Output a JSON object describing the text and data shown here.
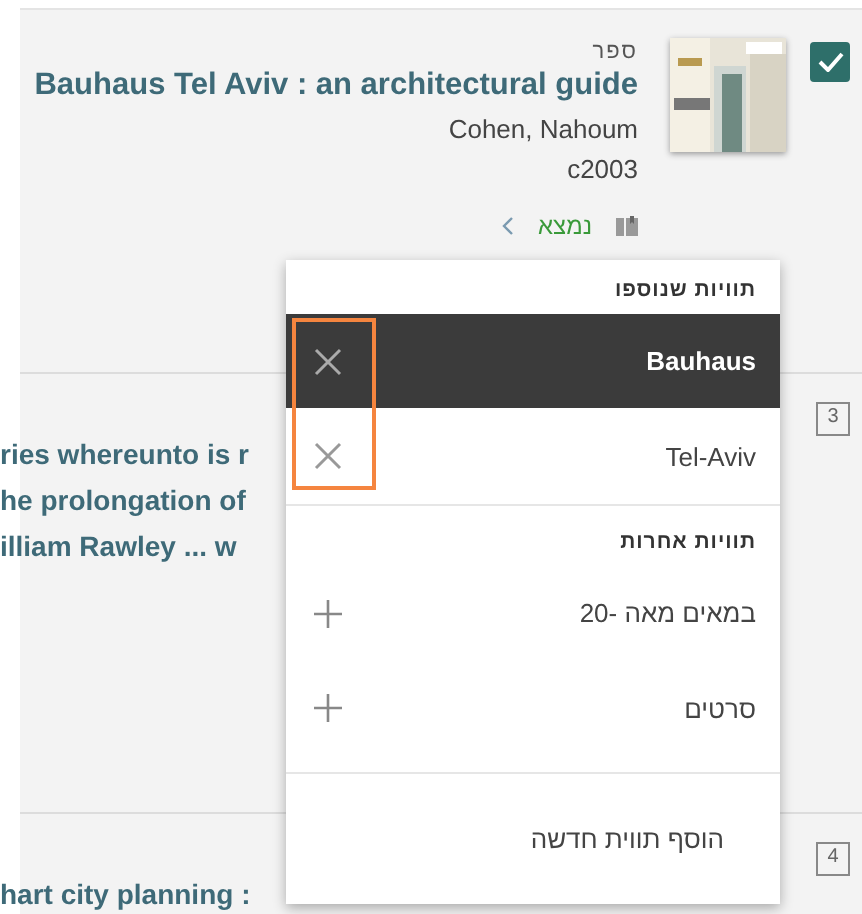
{
  "records": [
    {
      "kind": "full",
      "selected": true,
      "type": "ספר",
      "title": "Bauhaus Tel Aviv : an architectural guide",
      "author": "Cohen, Nahoum",
      "date": "c2003",
      "availability": "נמצא"
    },
    {
      "kind": "partial",
      "number": "3",
      "title_lines": [
        "ries whereunto is r",
        "he prolongation of",
        "illiam Rawley ... w"
      ]
    },
    {
      "kind": "partial",
      "number": "4",
      "title_lines": [
        "hart city planning :"
      ]
    }
  ],
  "tags_menu": {
    "added_header": "תוויות שנוספו",
    "added": [
      {
        "label": "Bauhaus",
        "selected": true
      },
      {
        "label": "Tel-Aviv",
        "selected": false
      }
    ],
    "other_header": "תוויות אחרות",
    "other": [
      {
        "label": "במאים מאה -20"
      },
      {
        "label": "סרטים"
      }
    ],
    "add_new": "הוסף תווית חדשה"
  }
}
